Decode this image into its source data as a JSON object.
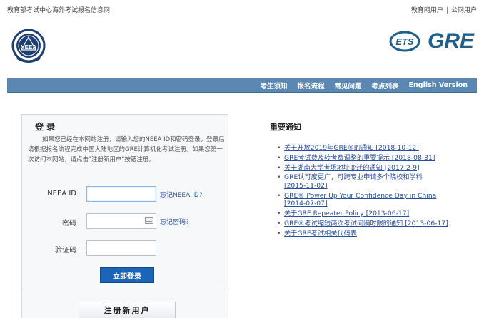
{
  "header": {
    "site_title": "教育部考试中心海外考试报名信息网",
    "links": [
      "教育网用户",
      "公网用户"
    ],
    "brand": {
      "ets": "ETS",
      "gre": "GRE"
    }
  },
  "nav": {
    "items": [
      "考生须知",
      "报名流程",
      "常见问题",
      "考点列表",
      "English Version"
    ]
  },
  "login": {
    "title": "登 录",
    "intro": "如果您已经在本网站注册，请输入您的NEEA ID和密码登录，登录后请根据报名流程完成中国大陆地区的GRE计算机化考试注册。如果您第一次访问本网站，请点击\"注册新用户\"按钮注册。",
    "fields": {
      "neea_id": {
        "label": "NEEA ID",
        "value": "",
        "link": "忘记NEEA ID?"
      },
      "password": {
        "label": "密码",
        "value": "",
        "link": "忘记密码?"
      },
      "captcha": {
        "label": "验证码",
        "value": ""
      }
    },
    "submit_label": "立即登录",
    "register_label": "注册新用户"
  },
  "notices": {
    "title": "重要通知",
    "items": [
      {
        "line1": "关于开放2019年GRE®的通知 [2018-10-12]",
        "line2": ""
      },
      {
        "line1": "GRE考试费及转考费调整的重要提示 [2018-08-31]",
        "line2": ""
      },
      {
        "line1": "关于湖南大学考场地址变迁的通知 [2017-2-9]",
        "line2": ""
      },
      {
        "line1": "GRE认可度更广，可跨专业申请多个院校和学科",
        "line2": "[2015-11-02]"
      },
      {
        "line1": "GRE® Power Up Your Confidence Day in China",
        "line2": "[2014-07-07]"
      },
      {
        "line1": "关于GRE Repeater Policy [2013-06-17]",
        "line2": ""
      },
      {
        "line1": "GRE®考试缩短两次考试间隔时限的通知 [2013-06-17]",
        "line2": ""
      },
      {
        "line1": "关于GRE考试相关代码表",
        "line2": ""
      }
    ]
  },
  "colors": {
    "nav_bg": "#5a88b3",
    "primary_button": "#1c64b7",
    "link": "#2b4fa1",
    "gre_brand": "#1f5f8b"
  }
}
